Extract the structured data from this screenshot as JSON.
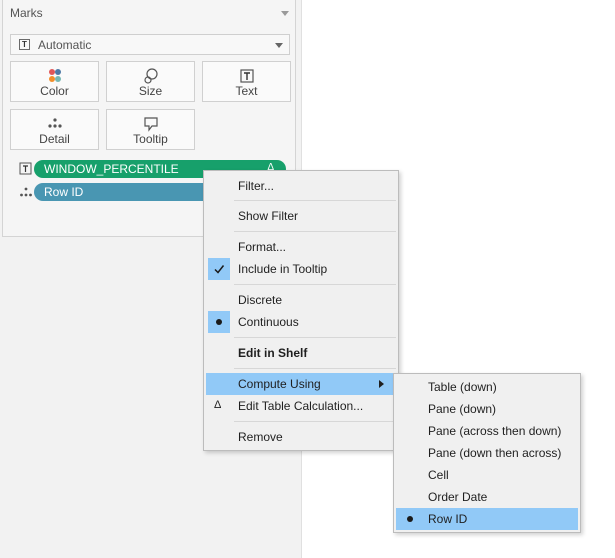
{
  "marks": {
    "title": "Marks",
    "mark_type": "Automatic",
    "buttons": [
      {
        "label": "Color",
        "icon": "color-dots-icon"
      },
      {
        "label": "Size",
        "icon": "size-circles-icon"
      },
      {
        "label": "Text",
        "icon": "text-box-icon"
      },
      {
        "label": "Detail",
        "icon": "detail-dots-icon"
      },
      {
        "label": "Tooltip",
        "icon": "tooltip-bubble-icon"
      }
    ],
    "pills": [
      {
        "label": "WINDOW_PERCENTILE",
        "icon": "text-box-icon",
        "color": "#17a06b",
        "table_calc_marker": "Δ"
      },
      {
        "label": "Row ID",
        "icon": "detail-dots-icon",
        "color": "#4996b2"
      }
    ]
  },
  "context_menu": {
    "items": [
      {
        "label": "Filter..."
      },
      {
        "label": "Show Filter"
      },
      {
        "label": "Format..."
      },
      {
        "label": "Include in Tooltip",
        "checked": true
      },
      {
        "label": "Discrete"
      },
      {
        "label": "Continuous",
        "selected": true
      },
      {
        "label": "Edit in Shelf",
        "bold": true
      },
      {
        "label": "Compute Using",
        "highlighted": true,
        "submenu": true
      },
      {
        "label": "Edit Table Calculation...",
        "icon": "Δ"
      },
      {
        "label": "Remove"
      }
    ]
  },
  "compute_using_submenu": {
    "items": [
      {
        "label": "Table (down)"
      },
      {
        "label": "Pane (down)"
      },
      {
        "label": "Pane (across then down)"
      },
      {
        "label": "Pane (down then across)"
      },
      {
        "label": "Cell"
      },
      {
        "label": "Order Date"
      },
      {
        "label": "Row ID",
        "selected": true,
        "highlighted": true
      }
    ]
  },
  "colors": {
    "highlight": "#91c9f7",
    "pill_green": "#17a06b",
    "pill_blue": "#4996b2",
    "menu_bg": "#f0f0f0"
  }
}
